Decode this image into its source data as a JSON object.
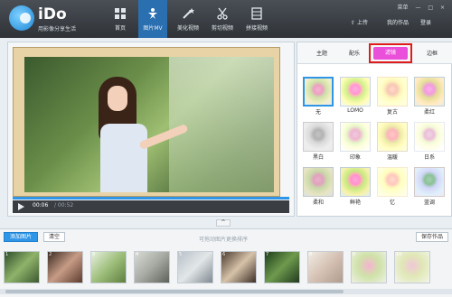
{
  "app": {
    "name": "iDo",
    "slogan": "用影像分享生活"
  },
  "nav": [
    {
      "label": "首页",
      "icon": "grid-icon"
    },
    {
      "label": "图片MV",
      "icon": "star-figure-icon"
    },
    {
      "label": "美化视频",
      "icon": "magic-wand-icon"
    },
    {
      "label": "剪切视频",
      "icon": "scissors-icon"
    },
    {
      "label": "拼接视频",
      "icon": "film-icon"
    }
  ],
  "window_controls": {
    "left": "菜单",
    "min": "—",
    "max": "□",
    "close": "×"
  },
  "top_right": {
    "upload": "上传",
    "my_works": "我的作品",
    "login": "登录"
  },
  "player": {
    "time_current": "00:06",
    "time_total": "/ 00:52"
  },
  "right_panel": {
    "tabs": [
      "主题",
      "配乐",
      "滤镜",
      "边框"
    ],
    "active_tab": "滤镜",
    "filters": [
      "无",
      "LOMO",
      "复古",
      "柔红",
      "黑白",
      "印象",
      "温暖",
      "日系",
      "柔和",
      "鲜艳",
      "忆",
      "蓝调"
    ]
  },
  "bottom": {
    "add_image": "添加图片",
    "clear": "清空",
    "hint": "可拖动图片更换排序",
    "save": "保存作品",
    "thumbnail_numbers": [
      "1",
      "2",
      "3",
      "4",
      "5",
      "6",
      "7",
      "8",
      "9",
      "10"
    ]
  },
  "colors": {
    "accent": "#2f95e6",
    "active_tab": "#ea4fd9",
    "highlight": "#e01b1b"
  }
}
